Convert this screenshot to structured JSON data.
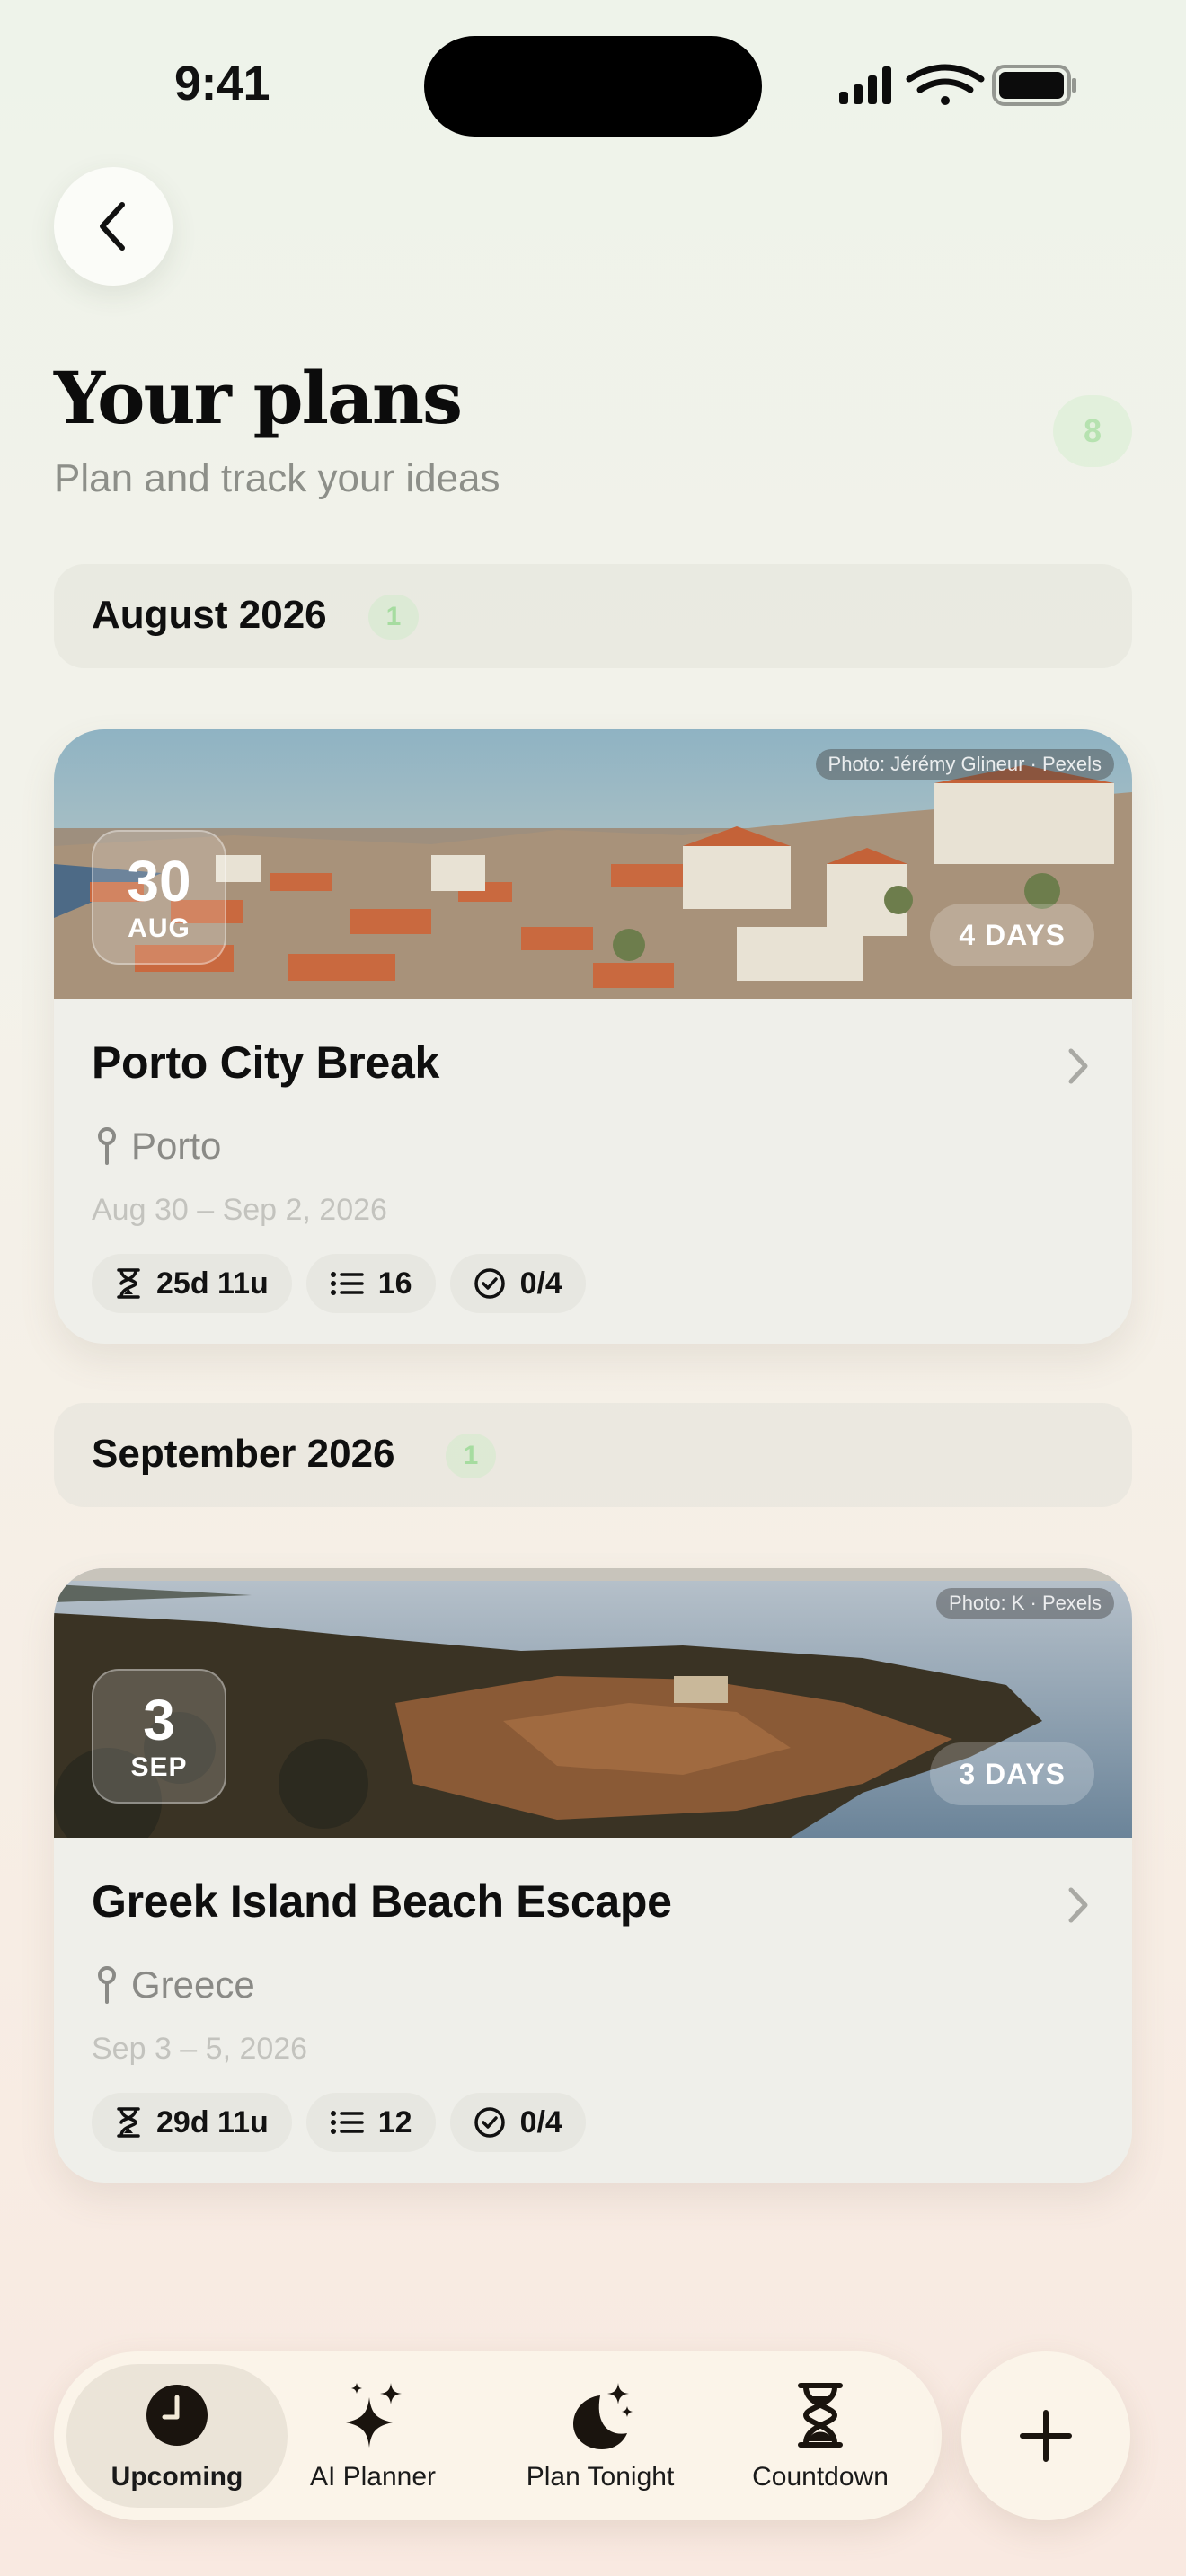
{
  "status_bar": {
    "time": "9:41"
  },
  "header": {
    "title": "Your plans",
    "subtitle": "Plan and track your ideas",
    "count": "8"
  },
  "sections": [
    {
      "month": "August 2026",
      "count": "1",
      "trip": {
        "title": "Porto City Break",
        "location": "Porto",
        "dates": "Aug 30 – Sep 2, 2026",
        "day": "30",
        "month_abbr": "AUG",
        "duration": "4 DAYS",
        "photo_credit": "Photo: Jérémy Glineur · Pexels",
        "countdown": "25d 11u",
        "items": "16",
        "checklist": "0/4"
      }
    },
    {
      "month": "September 2026",
      "count": "1",
      "trip": {
        "title": "Greek Island Beach Escape",
        "location": "Greece",
        "dates": "Sep 3 – 5, 2026",
        "day": "3",
        "month_abbr": "SEP",
        "duration": "3 DAYS",
        "photo_credit": "Photo: K · Pexels",
        "countdown": "29d 11u",
        "items": "12",
        "checklist": "0/4"
      }
    }
  ],
  "tab_bar": {
    "tabs": [
      {
        "label": "Upcoming",
        "icon": "clock-icon",
        "active": true
      },
      {
        "label": "AI Planner",
        "icon": "sparkles-icon",
        "active": false
      },
      {
        "label": "Plan Tonight",
        "icon": "moon-stars-icon",
        "active": false
      },
      {
        "label": "Countdown",
        "icon": "hourglass-icon",
        "active": false
      }
    ],
    "add_icon": "plus-icon"
  },
  "colors": {
    "accent_green": "#a6dca0",
    "tab_bar_bg": "#fbf4e9",
    "active_tab_bg": "#ebe4d8"
  }
}
